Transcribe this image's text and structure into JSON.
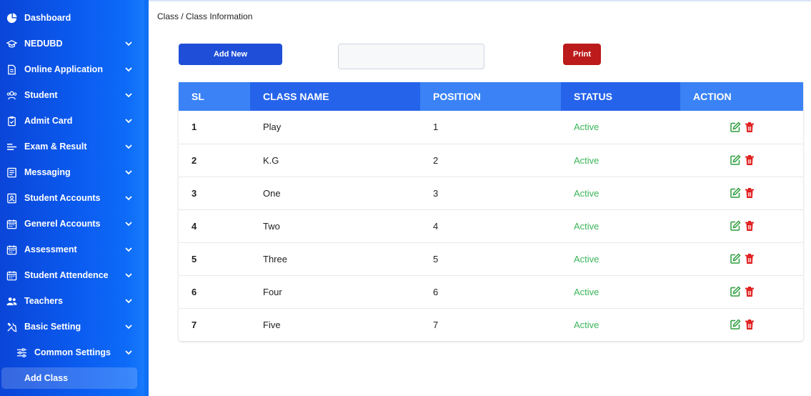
{
  "sidebar": {
    "items": [
      {
        "label": "Dashboard",
        "icon": "pie-chart-icon",
        "chevron": false
      },
      {
        "label": "NEDUBD",
        "icon": "graduation-cap-icon",
        "chevron": true
      },
      {
        "label": "Online Application",
        "icon": "document-icon",
        "chevron": true
      },
      {
        "label": "Student",
        "icon": "users-icon",
        "chevron": true
      },
      {
        "label": "Admit Card",
        "icon": "clipboard-icon",
        "chevron": true
      },
      {
        "label": "Exam & Result",
        "icon": "lines-icon",
        "chevron": true
      },
      {
        "label": "Messaging",
        "icon": "list-box-icon",
        "chevron": true
      },
      {
        "label": "Student Accounts",
        "icon": "id-card-icon",
        "chevron": true
      },
      {
        "label": "Generel Accounts",
        "icon": "calendar-icon",
        "chevron": true
      },
      {
        "label": "Assessment",
        "icon": "calendar-icon",
        "chevron": true
      },
      {
        "label": "Student Attendence",
        "icon": "calendar-icon",
        "chevron": true
      },
      {
        "label": "Teachers",
        "icon": "people-icon",
        "chevron": true
      },
      {
        "label": "Basic Setting",
        "icon": "tools-icon",
        "chevron": true
      }
    ],
    "sub_item": {
      "label": "Common Settings",
      "icon": "sliders-icon"
    },
    "active_item": {
      "label": "Add Class"
    }
  },
  "breadcrumb": "Class / Class Information",
  "toolbar": {
    "add_label": "Add New",
    "print_label": "Print",
    "search_value": "",
    "search_placeholder": ""
  },
  "table": {
    "headers": [
      "SL",
      "CLASS NAME",
      "POSITION",
      "STATUS",
      "ACTION"
    ],
    "rows": [
      {
        "sl": "1",
        "name": "Play",
        "position": "1",
        "status": "Active"
      },
      {
        "sl": "2",
        "name": "K.G",
        "position": "2",
        "status": "Active"
      },
      {
        "sl": "3",
        "name": "One",
        "position": "3",
        "status": "Active"
      },
      {
        "sl": "4",
        "name": "Two",
        "position": "4",
        "status": "Active"
      },
      {
        "sl": "5",
        "name": "Three",
        "position": "5",
        "status": "Active"
      },
      {
        "sl": "6",
        "name": "Four",
        "position": "6",
        "status": "Active"
      },
      {
        "sl": "7",
        "name": "Five",
        "position": "7",
        "status": "Active"
      }
    ]
  },
  "colors": {
    "sidebar": "#0b5cf0",
    "header_dark": "#2563eb",
    "header_light": "#3a82f5",
    "add_button": "#1f4fd8",
    "print_button": "#bb1b1b",
    "status_active": "#3cb55a",
    "edit_icon": "#2e9e3e",
    "delete_icon": "#e01b1b"
  }
}
